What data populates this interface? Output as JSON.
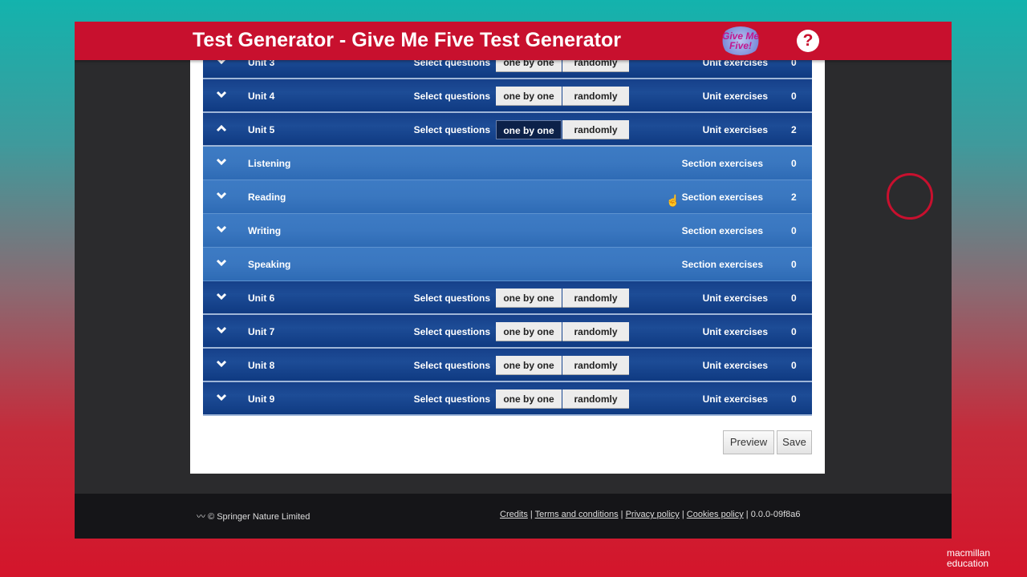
{
  "header": {
    "title": "Test Generator - Give Me Five Test Generator",
    "logo_text": "Give Me Five!",
    "help_icon": "question-circle-icon"
  },
  "labels": {
    "select_questions": "Select questions",
    "one_by_one": "one by one",
    "randomly": "randomly",
    "unit_exercises": "Unit exercises",
    "section_exercises": "Section exercises"
  },
  "rows": [
    {
      "type": "unit",
      "label": "Unit 3",
      "count": "0",
      "expanded": false,
      "mode": ""
    },
    {
      "type": "unit",
      "label": "Unit 4",
      "count": "0",
      "expanded": false,
      "mode": ""
    },
    {
      "type": "unit",
      "label": "Unit 5",
      "count": "2",
      "expanded": true,
      "mode": "one by one"
    },
    {
      "type": "section",
      "label": "Listening",
      "count": "0"
    },
    {
      "type": "section",
      "label": "Reading",
      "count": "2",
      "highlighted": true
    },
    {
      "type": "section",
      "label": "Writing",
      "count": "0"
    },
    {
      "type": "section",
      "label": "Speaking",
      "count": "0"
    },
    {
      "type": "unit",
      "label": "Unit 6",
      "count": "0",
      "expanded": false,
      "mode": ""
    },
    {
      "type": "unit",
      "label": "Unit 7",
      "count": "0",
      "expanded": false,
      "mode": ""
    },
    {
      "type": "unit",
      "label": "Unit 8",
      "count": "0",
      "expanded": false,
      "mode": ""
    },
    {
      "type": "unit",
      "label": "Unit 9",
      "count": "0",
      "expanded": false,
      "mode": ""
    }
  ],
  "actions": {
    "preview": "Preview",
    "save": "Save"
  },
  "footer": {
    "copyright": "© Springer Nature Limited",
    "links": [
      "Credits",
      "Terms and conditions",
      "Privacy policy",
      "Cookies policy"
    ],
    "version": "0.0.0-09f8a6"
  },
  "brand": {
    "line1": "macmillan",
    "line2": "education"
  },
  "colors": {
    "header": "#c8102e",
    "unit_row": "#16408a",
    "section_row": "#3a77c0"
  }
}
